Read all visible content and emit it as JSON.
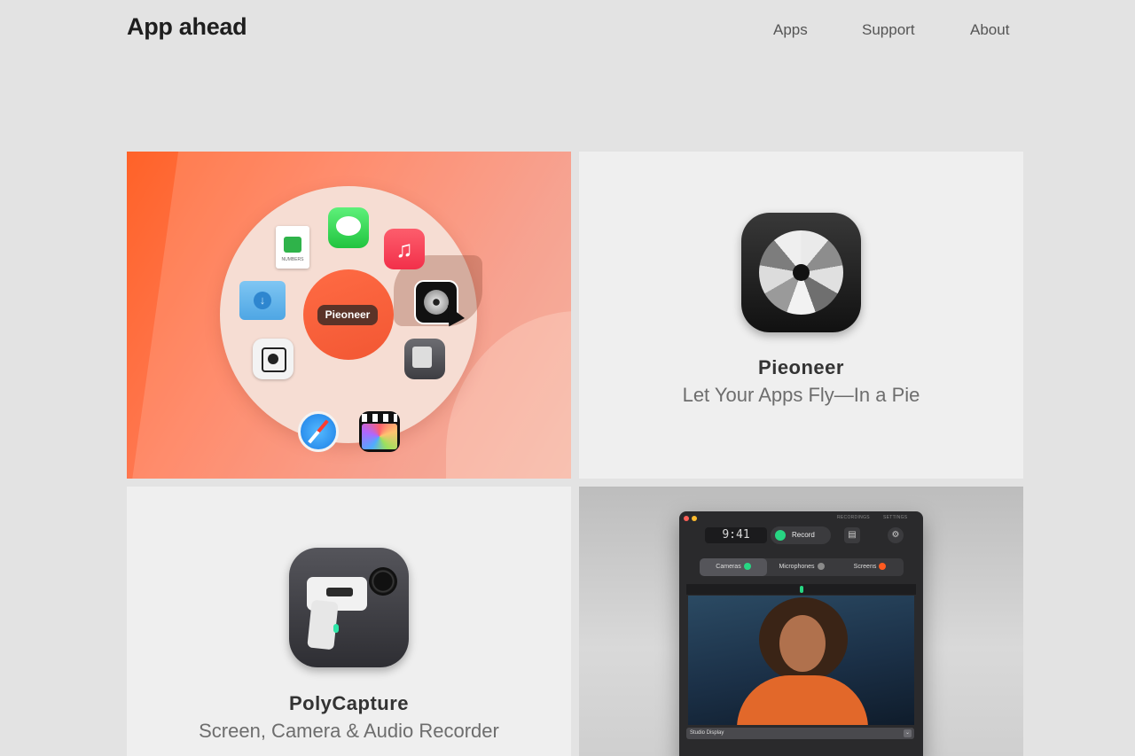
{
  "header": {
    "brand": "App ahead",
    "nav": {
      "apps": "Apps",
      "support": "Support",
      "about": "About"
    }
  },
  "hero": {
    "pie_label": "Pieoneer",
    "numbers_caption": "NUMBERS",
    "icons": [
      "numbers-icon",
      "messages-icon",
      "music-icon",
      "downloads-folder-icon",
      "pieoneer-icon",
      "screenshot-icon",
      "polycapture-icon",
      "safari-icon",
      "final-cut-pro-icon"
    ]
  },
  "pieoneer_tile": {
    "title": "Pieoneer",
    "subtitle": "Let Your Apps Fly—In a Pie"
  },
  "polycapture_tile": {
    "title": "PolyCapture",
    "subtitle": "Screen, Camera & Audio Recorder"
  },
  "app_window": {
    "tabs": {
      "recordings": "RECORDINGS",
      "settings": "SETTINGS"
    },
    "timer": "9:41",
    "record_label": "Record",
    "segments": {
      "cameras": "Cameras",
      "microphones": "Microphones",
      "screens": "Screens"
    },
    "device": "Studio Display",
    "colors": {
      "record_green": "#27d683",
      "alert_orange": "#ff5a1f"
    }
  },
  "colors": {
    "background": "#e3e3e3",
    "hero_orange": "#ff6228",
    "tile_bg": "#efefef"
  }
}
